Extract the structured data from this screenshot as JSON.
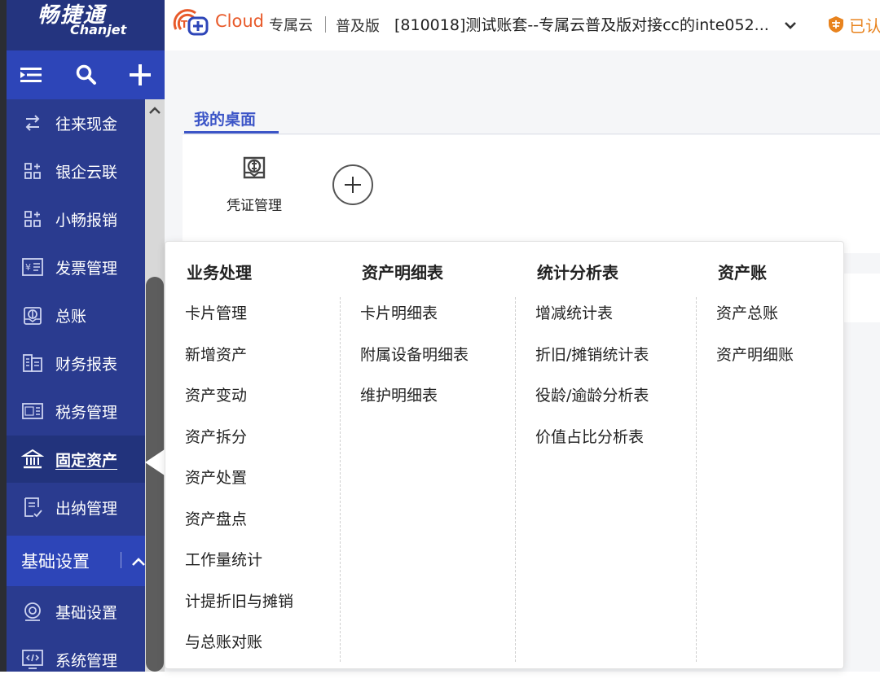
{
  "brand": {
    "name_cn": "畅捷通",
    "name_en": "Chanjet"
  },
  "header": {
    "cloud_label": "Cloud",
    "product": "专属云",
    "edition": "普及版",
    "account": "[810018]测试账套--专属云普及版对接cc的inte052...",
    "auth_status": "已认"
  },
  "sidebar": {
    "items": [
      {
        "label": "往来现金",
        "icon": "exchange-icon"
      },
      {
        "label": "银企云联",
        "icon": "grid-plus-icon"
      },
      {
        "label": "小畅报销",
        "icon": "grid-plus-icon"
      },
      {
        "label": "发票管理",
        "icon": "invoice-icon"
      },
      {
        "label": "总账",
        "icon": "ledger-icon"
      },
      {
        "label": "财务报表",
        "icon": "report-icon"
      },
      {
        "label": "税务管理",
        "icon": "tax-icon"
      },
      {
        "label": "固定资产",
        "icon": "bank-icon",
        "active": true
      },
      {
        "label": "出纳管理",
        "icon": "cashier-icon"
      }
    ],
    "section_label": "基础设置",
    "section_items": [
      {
        "label": "基础设置",
        "icon": "settings-icon"
      },
      {
        "label": "系统管理",
        "icon": "code-icon"
      }
    ]
  },
  "tabs": [
    {
      "label": "我的桌面",
      "active": true
    }
  ],
  "desktop": {
    "apps": [
      {
        "label": "凭证管理",
        "icon": "voucher-icon"
      }
    ]
  },
  "fixed_asset_menu": {
    "columns": [
      {
        "title": "业务处理",
        "items": [
          "卡片管理",
          "新增资产",
          "资产变动",
          "资产拆分",
          "资产处置",
          "资产盘点",
          "工作量统计",
          "计提折旧与摊销",
          "与总账对账"
        ]
      },
      {
        "title": "资产明细表",
        "items": [
          "卡片明细表",
          "附属设备明细表",
          "维护明细表"
        ]
      },
      {
        "title": "统计分析表",
        "items": [
          "增减统计表",
          "折旧/摊销统计表",
          "役龄/逾龄分析表",
          "价值占比分析表"
        ]
      },
      {
        "title": "资产账",
        "items": [
          "资产总账",
          "资产明细账"
        ]
      }
    ]
  },
  "colors": {
    "sidebar_bg": "#2a3b8f",
    "sidebar_toolbar": "#2d45b8",
    "accent": "#3c55c7",
    "brand_orange": "#e85a2a",
    "auth_orange": "#e8831e"
  }
}
